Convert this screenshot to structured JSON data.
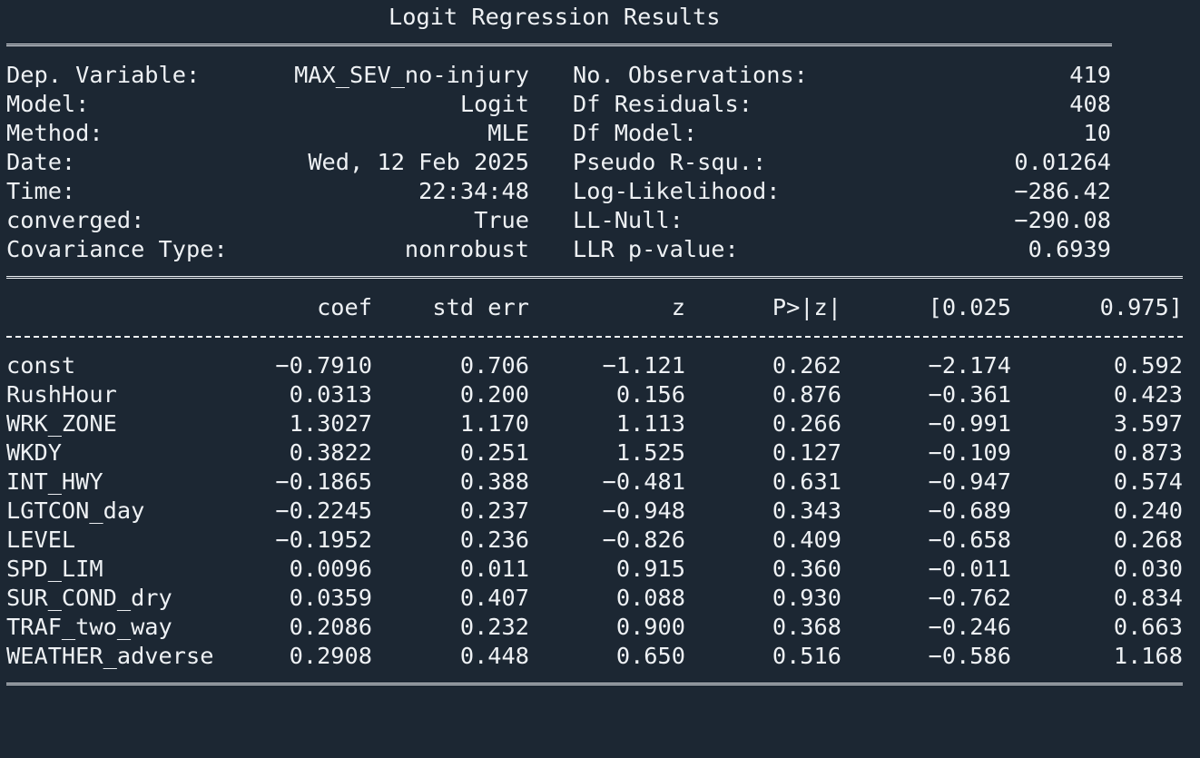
{
  "title": "Logit Regression Results",
  "summary_left": [
    {
      "label": "Dep. Variable:",
      "value": "MAX_SEV_no-injury"
    },
    {
      "label": "Model:",
      "value": "Logit"
    },
    {
      "label": "Method:",
      "value": "MLE"
    },
    {
      "label": "Date:",
      "value": "Wed, 12 Feb 2025"
    },
    {
      "label": "Time:",
      "value": "22:34:48"
    },
    {
      "label": "converged:",
      "value": "True"
    },
    {
      "label": "Covariance Type:",
      "value": "nonrobust"
    }
  ],
  "summary_right": [
    {
      "label": "No. Observations:",
      "value": "419"
    },
    {
      "label": "Df Residuals:",
      "value": "408"
    },
    {
      "label": "Df Model:",
      "value": "10"
    },
    {
      "label": "Pseudo R-squ.:",
      "value": "0.01264"
    },
    {
      "label": "Log-Likelihood:",
      "value": "-286.42"
    },
    {
      "label": "LL-Null:",
      "value": "-290.08"
    },
    {
      "label": "LLR p-value:",
      "value": "0.6939"
    }
  ],
  "coef_table": {
    "headers": [
      "coef",
      "std err",
      "z",
      "P>|z|",
      "[0.025",
      "0.975]"
    ],
    "rows": [
      {
        "name": "const",
        "coef": "-0.7910",
        "std_err": "0.706",
        "z": "-1.121",
        "p": "0.262",
        "ci_low": "-2.174",
        "ci_high": "0.592"
      },
      {
        "name": "RushHour",
        "coef": "0.0313",
        "std_err": "0.200",
        "z": "0.156",
        "p": "0.876",
        "ci_low": "-0.361",
        "ci_high": "0.423"
      },
      {
        "name": "WRK_ZONE",
        "coef": "1.3027",
        "std_err": "1.170",
        "z": "1.113",
        "p": "0.266",
        "ci_low": "-0.991",
        "ci_high": "3.597"
      },
      {
        "name": "WKDY",
        "coef": "0.3822",
        "std_err": "0.251",
        "z": "1.525",
        "p": "0.127",
        "ci_low": "-0.109",
        "ci_high": "0.873"
      },
      {
        "name": "INT_HWY",
        "coef": "-0.1865",
        "std_err": "0.388",
        "z": "-0.481",
        "p": "0.631",
        "ci_low": "-0.947",
        "ci_high": "0.574"
      },
      {
        "name": "LGTCON_day",
        "coef": "-0.2245",
        "std_err": "0.237",
        "z": "-0.948",
        "p": "0.343",
        "ci_low": "-0.689",
        "ci_high": "0.240"
      },
      {
        "name": "LEVEL",
        "coef": "-0.1952",
        "std_err": "0.236",
        "z": "-0.826",
        "p": "0.409",
        "ci_low": "-0.658",
        "ci_high": "0.268"
      },
      {
        "name": "SPD_LIM",
        "coef": "0.0096",
        "std_err": "0.011",
        "z": "0.915",
        "p": "0.360",
        "ci_low": "-0.011",
        "ci_high": "0.030"
      },
      {
        "name": "SUR_COND_dry",
        "coef": "0.0359",
        "std_err": "0.407",
        "z": "0.088",
        "p": "0.930",
        "ci_low": "-0.762",
        "ci_high": "0.834"
      },
      {
        "name": "TRAF_two_way",
        "coef": "0.2086",
        "std_err": "0.232",
        "z": "0.900",
        "p": "0.368",
        "ci_low": "-0.246",
        "ci_high": "0.663"
      },
      {
        "name": "WEATHER_adverse",
        "coef": "0.2908",
        "std_err": "0.448",
        "z": "0.650",
        "p": "0.516",
        "ci_low": "-0.586",
        "ci_high": "1.168"
      }
    ]
  },
  "colors": {
    "background": "#1c2733",
    "text": "#eef1f4"
  }
}
